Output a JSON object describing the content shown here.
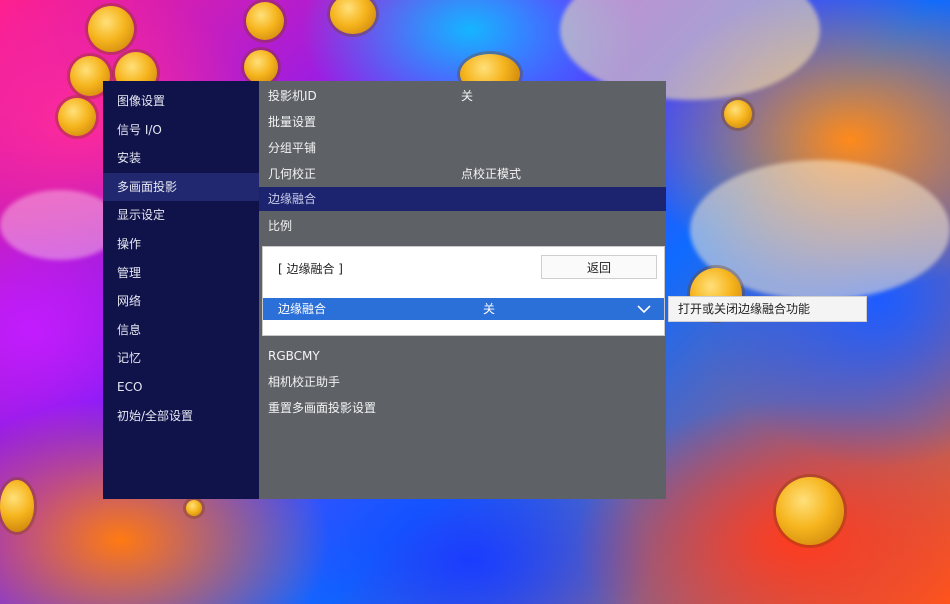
{
  "sidebar": {
    "items": [
      {
        "label": "图像设置"
      },
      {
        "label": "信号 I/O"
      },
      {
        "label": "安装"
      },
      {
        "label": "多画面投影",
        "active": true
      },
      {
        "label": "显示设定"
      },
      {
        "label": "操作"
      },
      {
        "label": "管理"
      },
      {
        "label": "网络"
      },
      {
        "label": "信息"
      },
      {
        "label": "记忆"
      },
      {
        "label": "ECO"
      },
      {
        "label": "初始/全部设置"
      }
    ]
  },
  "content": {
    "rows": [
      {
        "label": "投影机ID",
        "value": "关"
      },
      {
        "label": "批量设置",
        "value": ""
      },
      {
        "label": "分组平铺",
        "value": ""
      },
      {
        "label": "几何校正",
        "value": "点校正模式"
      },
      {
        "label": "边缘融合",
        "value": "",
        "highlighted": true
      },
      {
        "label": "比例",
        "value": ""
      },
      {
        "label": "RGBCMY",
        "value": ""
      },
      {
        "label": "相机校正助手",
        "value": ""
      },
      {
        "label": "重置多画面投影设置",
        "value": ""
      }
    ]
  },
  "dialog": {
    "title": "[ 边缘融合 ]",
    "back_label": "返回",
    "setting_label": "边缘融合",
    "setting_value": "关",
    "dropdown_icon": "chevron-down-icon"
  },
  "tooltip": {
    "text": "打开或关闭边缘融合功能"
  }
}
